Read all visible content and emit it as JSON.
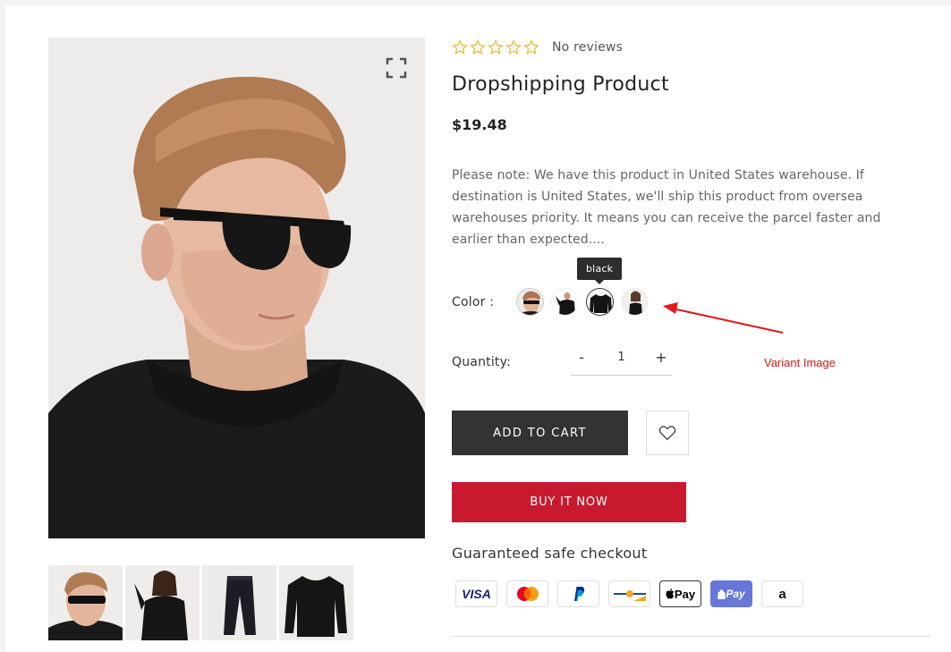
{
  "product": {
    "rating_text": "No reviews",
    "title": "Dropshipping Product",
    "price": "$19.48",
    "description": "Please note: We have this product in United States warehouse. If destination is United States, we'll ship this product from oversea warehouses priority. It means you can receive the parcel faster and earlier than expected...."
  },
  "color": {
    "label": "Color :",
    "tooltip": "black",
    "options": [
      "sunglasses",
      "black-top",
      "black",
      "black-tank"
    ]
  },
  "quantity": {
    "label": "Quantity:",
    "minus": "-",
    "plus": "+",
    "value": "1"
  },
  "annotation": {
    "text": "Variant Image",
    "color": "#d01818"
  },
  "actions": {
    "add_to_cart": "ADD TO CART",
    "buy_now": "BUY IT NOW"
  },
  "checkout": {
    "title": "Guaranteed safe checkout",
    "methods": {
      "visa": "VISA",
      "paypal": "P",
      "applepay": "Pay",
      "shoppay": "Pay",
      "amazon": "a"
    }
  },
  "colors": {
    "buy_now": "#c8192e",
    "add_to_cart": "#333333",
    "tooltip_bg": "#2d2d2d"
  }
}
